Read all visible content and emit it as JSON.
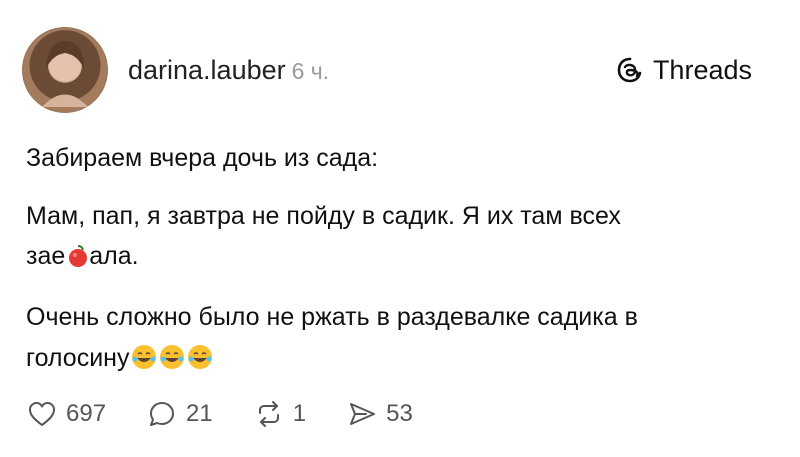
{
  "post": {
    "author": "darina.lauber",
    "time": "6 ч.",
    "lines": [
      "Забираем вчера дочь из сада:",
      "Мам, пап, я завтра не пойду в садик. Я их там всех",
      "зае",
      "ала.",
      "Очень сложно было не ржать в раздевалке садика в",
      "голосину"
    ],
    "emojis": [
      "censor-cherry-emoji",
      "laughing-tears-emoji",
      "laughing-tears-emoji",
      "laughing-tears-emoji"
    ]
  },
  "brand": {
    "label": "Threads",
    "icon": "threads-logo-icon"
  },
  "actions": [
    {
      "name": "like",
      "icon": "heart-icon",
      "count": "697"
    },
    {
      "name": "comment",
      "icon": "comment-icon",
      "count": "21"
    },
    {
      "name": "repost",
      "icon": "repost-icon",
      "count": "1"
    },
    {
      "name": "share",
      "icon": "send-icon",
      "count": "53"
    }
  ]
}
